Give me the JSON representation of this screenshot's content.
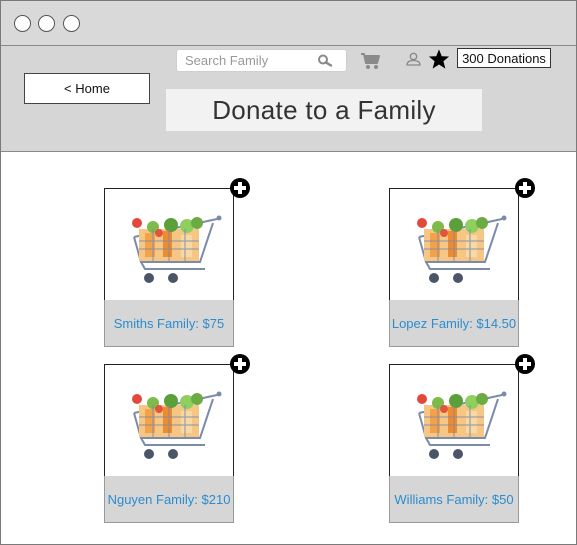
{
  "header": {
    "home_label": "< Home",
    "search_placeholder": "Search Family",
    "donations_label": "300 Donations",
    "page_title": "Donate to a Family"
  },
  "icons": {
    "window_controls": [
      "circle-icon",
      "circle-icon",
      "circle-icon"
    ],
    "search": "search-icon",
    "cart": "cart-icon",
    "user": "user-icon",
    "star": "star-icon",
    "add": "plus-circle-icon",
    "family_image": "grocery-cart-icon"
  },
  "families": [
    {
      "label": "Smiths Family: $75"
    },
    {
      "label": "Lopez Family: $14.50"
    },
    {
      "label": "Nguyen Family: $210"
    },
    {
      "label": "Williams Family: $50"
    }
  ],
  "colors": {
    "accent_text": "#2b8ccf",
    "header_bg": "#d6d6d6"
  }
}
